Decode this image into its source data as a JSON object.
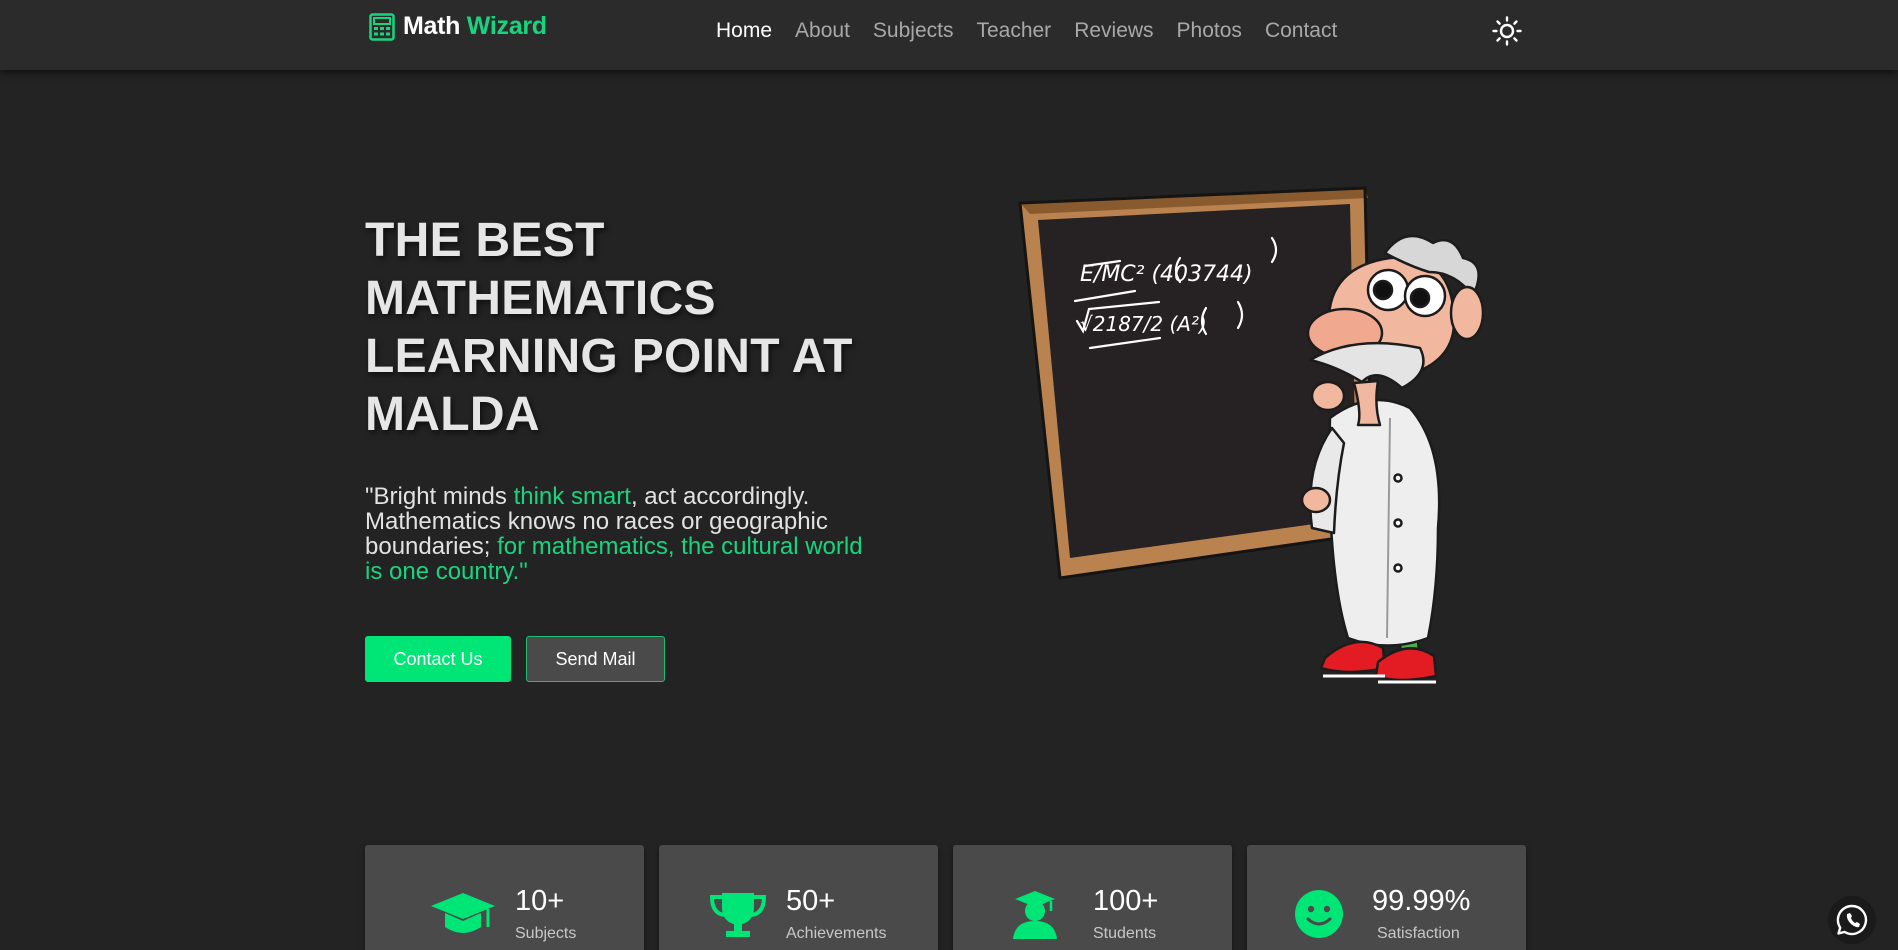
{
  "brand": {
    "name_part1": "Math",
    "name_part2": "Wizard",
    "logo_icon": "calculator-icon"
  },
  "nav": {
    "items": [
      {
        "label": "Home",
        "active": true
      },
      {
        "label": "About",
        "active": false
      },
      {
        "label": "Subjects",
        "active": false
      },
      {
        "label": "Teacher",
        "active": false
      },
      {
        "label": "Reviews",
        "active": false
      },
      {
        "label": "Photos",
        "active": false
      },
      {
        "label": "Contact",
        "active": false
      }
    ],
    "theme_toggle_icon": "sun-icon"
  },
  "hero": {
    "title": "THE BEST MATHEMATICS LEARNING POINT AT MALDA",
    "quote": {
      "part1": "\"Bright minds ",
      "highlight1": "think smart",
      "part2": ", act accordingly. Mathematics knows no races or geographic boundaries; ",
      "highlight2": "for mathematics, the cultural world is one country.\""
    },
    "contact_button": "Contact Us",
    "mail_button": "Send Mail",
    "illustration": {
      "board_line1": "E/MC² (403744)",
      "board_line2": "√2187/2   (A²)"
    }
  },
  "stats": [
    {
      "value": "10+",
      "label": "Subjects",
      "icon": "graduation-cap-icon"
    },
    {
      "value": "50+",
      "label": "Achievements",
      "icon": "trophy-icon"
    },
    {
      "value": "100+",
      "label": "Students",
      "icon": "student-icon"
    },
    {
      "value": "99.99%",
      "label": "Satisfaction",
      "icon": "smile-icon"
    }
  ],
  "whatsapp_icon": "whatsapp-icon",
  "colors": {
    "accent": "#19d47f",
    "button_green": "#00e676",
    "background": "#232323",
    "navbar": "#2b2b2b",
    "card": "#4a4a4a"
  }
}
